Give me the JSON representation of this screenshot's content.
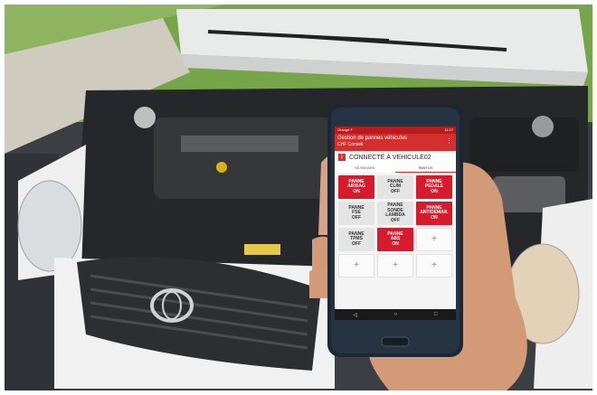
{
  "colors": {
    "accent": "#d32f2f",
    "car": "#f2f2f2",
    "grass": "#6a9a3a"
  },
  "phone": {
    "status_left": "Orange F",
    "status_right": "11:27",
    "app_title": "Gestion de pannes véhicules",
    "app_subtitle": "CHF Conseil",
    "menu_icon": "⋮",
    "connection": "CONNECTÉ À VEHICULE02",
    "tabs": [
      "KEYBOARD",
      "SWITCH"
    ],
    "tiles": [
      {
        "l1": "PANNE",
        "l2": "AIRBAG",
        "state": "ON",
        "style": "on"
      },
      {
        "l1": "PANNE",
        "l2": "CLIM",
        "state": "OFF",
        "style": "off"
      },
      {
        "l1": "PANNE",
        "l2": "PEDALE",
        "state": "ON",
        "style": "on"
      },
      {
        "l1": "PANNE",
        "l2": "FSE",
        "state": "OFF",
        "style": "off"
      },
      {
        "l1": "PANNE",
        "l2": "SONDE LAMBDA",
        "state": "OFF",
        "style": "off"
      },
      {
        "l1": "PANNE",
        "l2": "ANTIDEMAR.",
        "state": "ON",
        "style": "on"
      },
      {
        "l1": "PANNE",
        "l2": "TPMS",
        "state": "OFF",
        "style": "off"
      },
      {
        "l1": "PANNE",
        "l2": "ABS",
        "state": "ON",
        "style": "on"
      },
      {
        "l1": "+",
        "l2": "",
        "state": "",
        "style": "add"
      },
      {
        "l1": "+",
        "l2": "",
        "state": "",
        "style": "add"
      },
      {
        "l1": "+",
        "l2": "",
        "state": "",
        "style": "add"
      },
      {
        "l1": "+",
        "l2": "",
        "state": "",
        "style": "add"
      }
    ],
    "nav": [
      "◁",
      "○",
      "□"
    ]
  }
}
